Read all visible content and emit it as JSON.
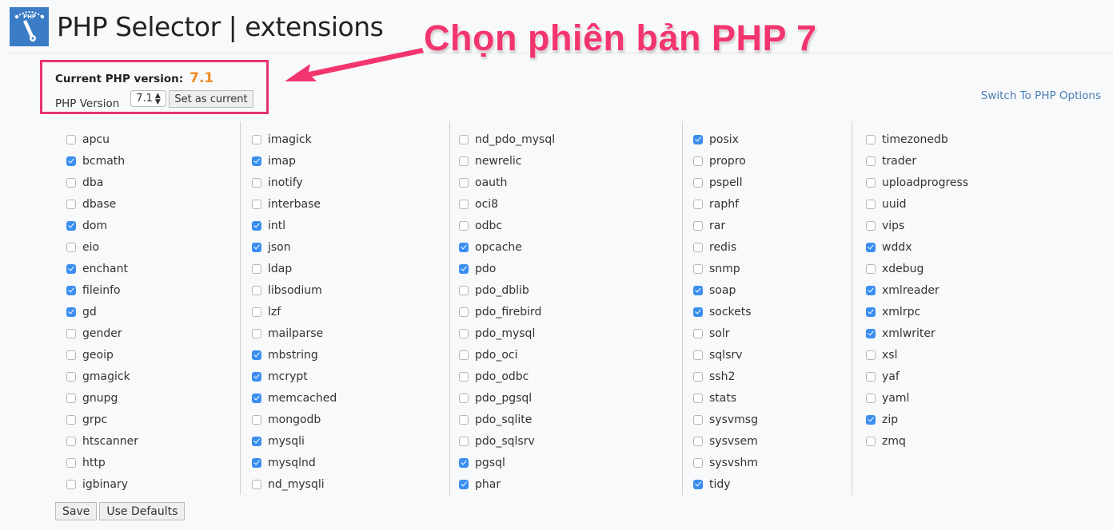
{
  "header": {
    "title": "PHP Selector | extensions",
    "logo_icon": "php-gauge-logo-icon",
    "logo_text": "PHP"
  },
  "annotation": {
    "text": "Chọn phiên bản PHP 7",
    "color": "#f2356f"
  },
  "version_panel": {
    "current_label": "Current PHP version:",
    "current_value": "7.1",
    "php_version_label": "PHP Version",
    "selected_version": "7.1",
    "set_current_label": "Set as current"
  },
  "switch_link": "Switch To PHP Options",
  "extensions": {
    "columns": [
      [
        {
          "name": "apcu",
          "checked": false
        },
        {
          "name": "bcmath",
          "checked": true
        },
        {
          "name": "dba",
          "checked": false
        },
        {
          "name": "dbase",
          "checked": false
        },
        {
          "name": "dom",
          "checked": true
        },
        {
          "name": "eio",
          "checked": false
        },
        {
          "name": "enchant",
          "checked": true
        },
        {
          "name": "fileinfo",
          "checked": true
        },
        {
          "name": "gd",
          "checked": true
        },
        {
          "name": "gender",
          "checked": false
        },
        {
          "name": "geoip",
          "checked": false
        },
        {
          "name": "gmagick",
          "checked": false
        },
        {
          "name": "gnupg",
          "checked": false
        },
        {
          "name": "grpc",
          "checked": false
        },
        {
          "name": "htscanner",
          "checked": false
        },
        {
          "name": "http",
          "checked": false
        },
        {
          "name": "igbinary",
          "checked": false
        }
      ],
      [
        {
          "name": "imagick",
          "checked": false
        },
        {
          "name": "imap",
          "checked": true
        },
        {
          "name": "inotify",
          "checked": false
        },
        {
          "name": "interbase",
          "checked": false
        },
        {
          "name": "intl",
          "checked": true
        },
        {
          "name": "json",
          "checked": true
        },
        {
          "name": "ldap",
          "checked": false
        },
        {
          "name": "libsodium",
          "checked": false
        },
        {
          "name": "lzf",
          "checked": false
        },
        {
          "name": "mailparse",
          "checked": false
        },
        {
          "name": "mbstring",
          "checked": true
        },
        {
          "name": "mcrypt",
          "checked": true
        },
        {
          "name": "memcached",
          "checked": true
        },
        {
          "name": "mongodb",
          "checked": false
        },
        {
          "name": "mysqli",
          "checked": true
        },
        {
          "name": "mysqlnd",
          "checked": true
        },
        {
          "name": "nd_mysqli",
          "checked": false
        }
      ],
      [
        {
          "name": "nd_pdo_mysql",
          "checked": false
        },
        {
          "name": "newrelic",
          "checked": false
        },
        {
          "name": "oauth",
          "checked": false
        },
        {
          "name": "oci8",
          "checked": false
        },
        {
          "name": "odbc",
          "checked": false
        },
        {
          "name": "opcache",
          "checked": true
        },
        {
          "name": "pdo",
          "checked": true
        },
        {
          "name": "pdo_dblib",
          "checked": false
        },
        {
          "name": "pdo_firebird",
          "checked": false
        },
        {
          "name": "pdo_mysql",
          "checked": false
        },
        {
          "name": "pdo_oci",
          "checked": false
        },
        {
          "name": "pdo_odbc",
          "checked": false
        },
        {
          "name": "pdo_pgsql",
          "checked": false
        },
        {
          "name": "pdo_sqlite",
          "checked": false
        },
        {
          "name": "pdo_sqlsrv",
          "checked": false
        },
        {
          "name": "pgsql",
          "checked": true
        },
        {
          "name": "phar",
          "checked": true
        }
      ],
      [
        {
          "name": "posix",
          "checked": true
        },
        {
          "name": "propro",
          "checked": false
        },
        {
          "name": "pspell",
          "checked": false
        },
        {
          "name": "raphf",
          "checked": false
        },
        {
          "name": "rar",
          "checked": false
        },
        {
          "name": "redis",
          "checked": false
        },
        {
          "name": "snmp",
          "checked": false
        },
        {
          "name": "soap",
          "checked": true
        },
        {
          "name": "sockets",
          "checked": true
        },
        {
          "name": "solr",
          "checked": false
        },
        {
          "name": "sqlsrv",
          "checked": false
        },
        {
          "name": "ssh2",
          "checked": false
        },
        {
          "name": "stats",
          "checked": false
        },
        {
          "name": "sysvmsg",
          "checked": false
        },
        {
          "name": "sysvsem",
          "checked": false
        },
        {
          "name": "sysvshm",
          "checked": false
        },
        {
          "name": "tidy",
          "checked": true
        }
      ],
      [
        {
          "name": "timezonedb",
          "checked": false
        },
        {
          "name": "trader",
          "checked": false
        },
        {
          "name": "uploadprogress",
          "checked": false
        },
        {
          "name": "uuid",
          "checked": false
        },
        {
          "name": "vips",
          "checked": false
        },
        {
          "name": "wddx",
          "checked": true
        },
        {
          "name": "xdebug",
          "checked": false
        },
        {
          "name": "xmlreader",
          "checked": true
        },
        {
          "name": "xmlrpc",
          "checked": true
        },
        {
          "name": "xmlwriter",
          "checked": true
        },
        {
          "name": "xsl",
          "checked": false
        },
        {
          "name": "yaf",
          "checked": false
        },
        {
          "name": "yaml",
          "checked": false
        },
        {
          "name": "zip",
          "checked": true
        },
        {
          "name": "zmq",
          "checked": false
        }
      ]
    ]
  },
  "footer": {
    "save_label": "Save",
    "defaults_label": "Use Defaults"
  },
  "colors": {
    "accent_orange": "#f08a24",
    "checkbox_blue": "#3a8ef0",
    "link_blue": "#4a7db5",
    "highlight_pink": "#e8356d"
  }
}
